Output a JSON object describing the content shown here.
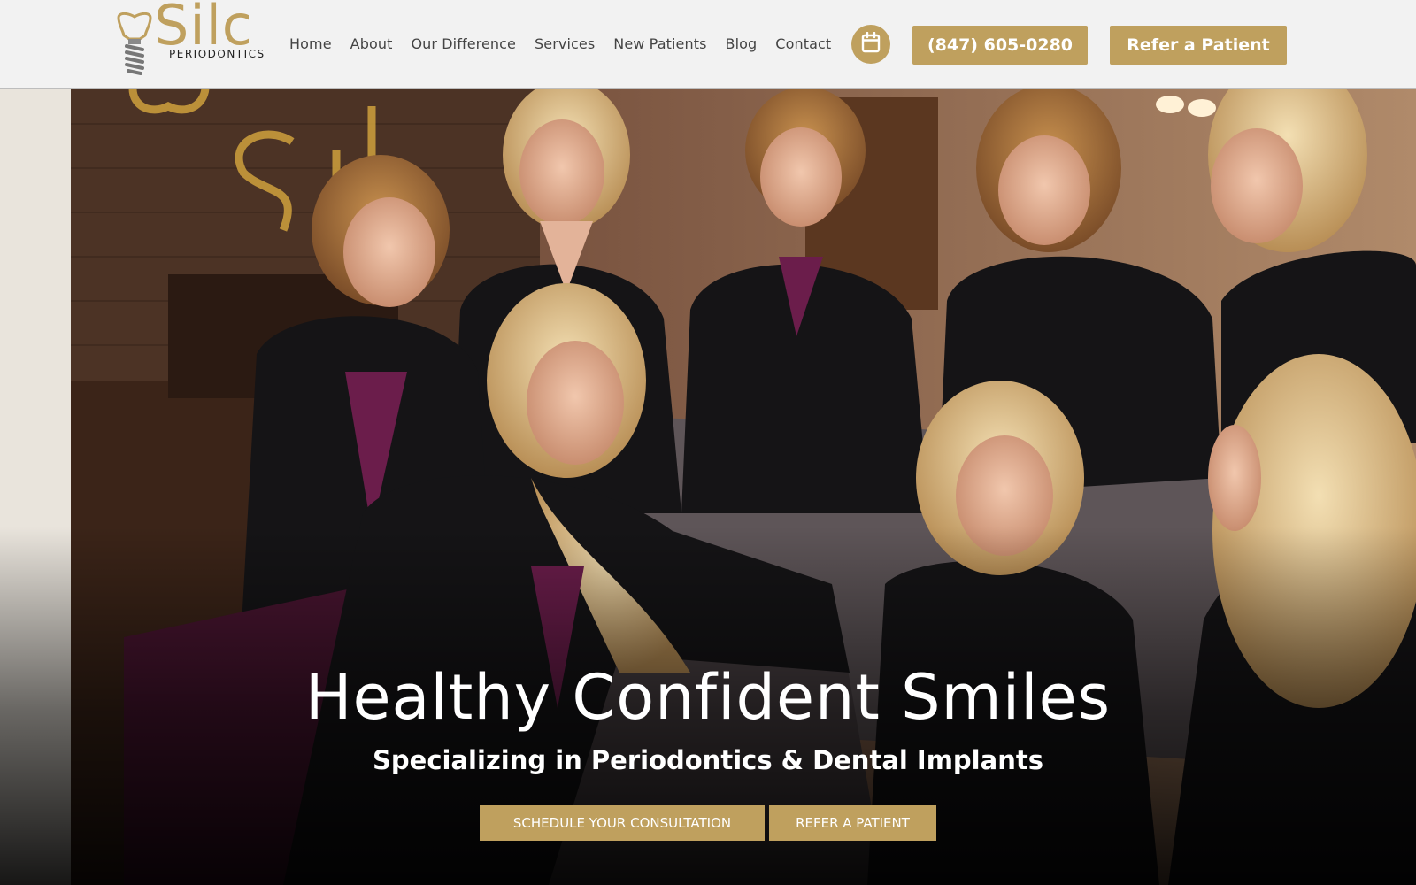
{
  "header": {
    "logo": {
      "wordmark": "Silc",
      "subtitle": "PERIODONTICS",
      "icon": "tooth-implant-icon"
    },
    "nav": [
      {
        "label": "Home"
      },
      {
        "label": "About"
      },
      {
        "label": "Our Difference"
      },
      {
        "label": "Services"
      },
      {
        "label": "New Patients"
      },
      {
        "label": "Blog"
      },
      {
        "label": "Contact"
      }
    ],
    "calendar_icon": "calendar-icon",
    "phone_label": "(847) 605-0280",
    "refer_label": "Refer a Patient"
  },
  "hero": {
    "title": "Healthy Confident Smiles",
    "subtitle": "Specializing in Periodontics & Dental Implants",
    "cta_schedule": "SCHEDULE YOUR CONSULTATION",
    "cta_refer": "REFER A PATIENT"
  },
  "colors": {
    "accent": "#bfa05e",
    "header_bg": "#f2f2f2",
    "nav_text": "#444444"
  }
}
